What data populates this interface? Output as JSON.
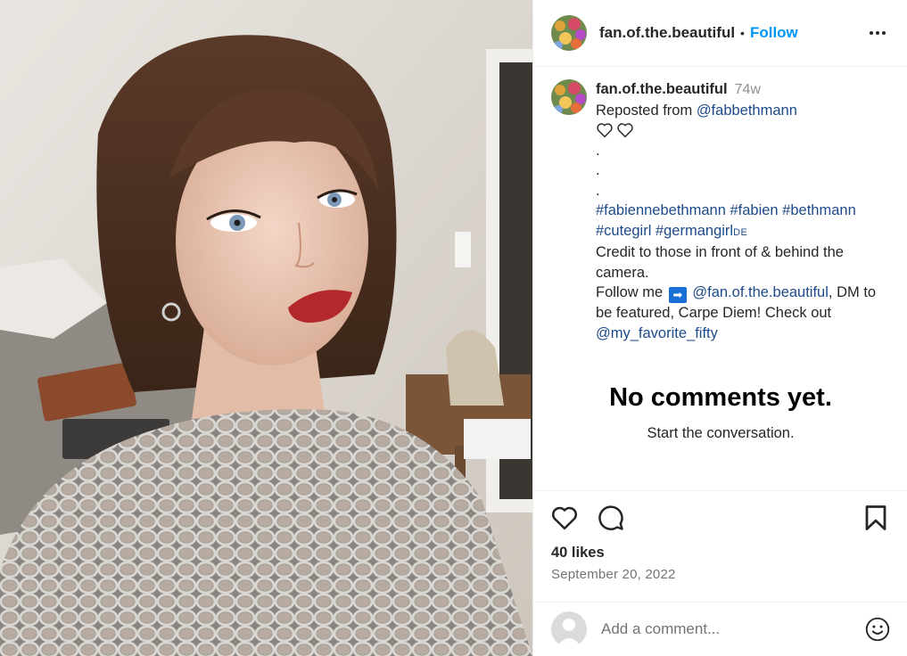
{
  "header": {
    "username": "fan.of.the.beautiful",
    "separator": "•",
    "follow_label": "Follow"
  },
  "caption": {
    "username": "fan.of.the.beautiful",
    "time_ago": "74w",
    "reposted_prefix": "Reposted from ",
    "reposted_handle": "@fabbethmann",
    "dots": [
      ".",
      ".",
      "."
    ],
    "hashtags_line1": "#fabiennebethmann #fabien #bethmann",
    "hashtags_line2": "#cutegirl #germangirl🇩🇪",
    "hashtags_line2_text": "#cutegirl #germangirl",
    "hashtags_line2_flag": "DE",
    "credit": "Credit to those in front of & behind the camera.",
    "follow_prefix": "Follow me",
    "follow_arrow": "➡",
    "follow_handle": "@fan.of.the.beautiful",
    "follow_suffix": ", DM to be featured, Carpe Diem! Check out ",
    "checkout_handle": "@my_favorite_fifty"
  },
  "empty_state": {
    "title": "No comments yet.",
    "subtitle": "Start the conversation."
  },
  "stats": {
    "likes": "40 likes",
    "date": "September 20, 2022"
  },
  "comment_box": {
    "placeholder": "Add a comment..."
  },
  "icons": {
    "like": "heart-icon",
    "comment": "comment-bubble-icon",
    "save": "bookmark-icon",
    "more": "more-options-icon",
    "emoji": "smiley-icon"
  },
  "colors": {
    "link_blue": "#0095f6",
    "mention_blue": "#1e4a8a",
    "muted": "#737373"
  }
}
